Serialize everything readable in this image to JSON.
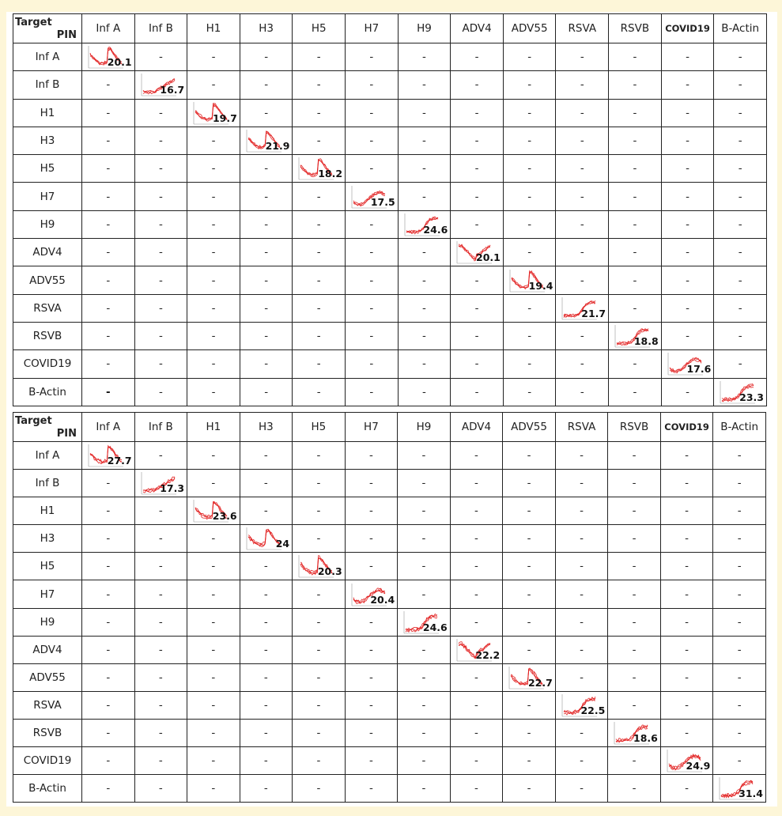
{
  "corner": {
    "col_label": "PIN",
    "row_label": "Target"
  },
  "columns": [
    "Inf A",
    "Inf B",
    "H1",
    "H3",
    "H5",
    "H7",
    "H9",
    "ADV4",
    "ADV55",
    "RSVA",
    "RSVB",
    "COVID19",
    "B-Actin"
  ],
  "rows": [
    "Inf A",
    "Inf B",
    "H1",
    "H3",
    "H5",
    "H7",
    "H9",
    "ADV4",
    "ADV55",
    "RSVA",
    "RSVB",
    "COVID19",
    "B-Actin"
  ],
  "empty_symbol": "-",
  "curve_color": "#e01818",
  "tables": [
    {
      "name": "table-1",
      "diagonal_ct": [
        "20.1",
        "16.7",
        "19.7",
        "21.9",
        "18.2",
        "17.5",
        "24.6",
        "20.1",
        "19.4",
        "21.7",
        "18.8",
        "17.6",
        "23.3"
      ]
    },
    {
      "name": "table-2",
      "diagonal_ct": [
        "27.7",
        "17.3",
        "23.6",
        "24",
        "20.3",
        "20.4",
        "24.6",
        "22.2",
        "22.7",
        "22.5",
        "18.6",
        "24.9",
        "31.4"
      ]
    }
  ]
}
